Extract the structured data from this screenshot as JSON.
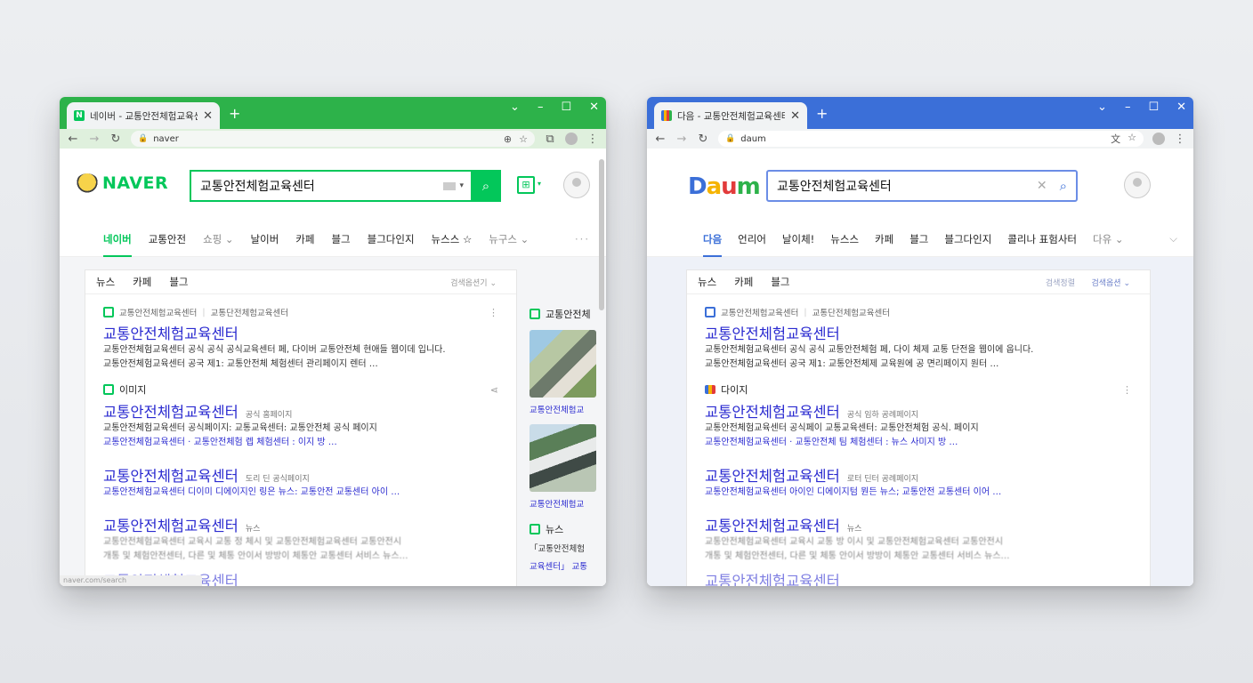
{
  "naver": {
    "tab_title": "네이버 - 교통안전체험교육센터",
    "address": "naver",
    "logo": "NAVER",
    "search_value": "교통안전체험교육센터",
    "menu": [
      "네이버",
      "교통안전",
      "쇼핑",
      "날이버",
      "카페",
      "블그",
      "블그다인지",
      "뉴스스",
      "뉴구스"
    ],
    "menu_more": "···",
    "panel_tabs": [
      "뉴스",
      "카페",
      "블그"
    ],
    "sort_label": "검색옵션기",
    "results": [
      {
        "source": "교통안전체험교육센터",
        "source2": "교통단전체험교육센터",
        "title": "교통안전체험교육센터",
        "lines": [
          "교통안전체험교육센터 공식 공식 공식교육센터 페, 다이버 교통안전체 현애들 웹이데 입니다.",
          "교통안전체험교육센터 공국 제1: 교통안전체 체험센터 관리페이지 렌터 …"
        ]
      },
      {
        "source": "이미지",
        "title": "교통안전체험교육센터",
        "subtitle": "공식 홈페이지",
        "lines": [
          "교통안전체험교육센터 공식페이지: 교통교육센터: 교통안전체 공식 페이지",
          "교통안전체험교육센터 · 교통안전체험 렙 체험센터 : 이지 방 …"
        ]
      },
      {
        "title": "교통안전체험교육센터",
        "subtitle": "도리 딘 공식페이지",
        "lines": [
          "교통안전체험교육센터 디이미 디에이지인 링은 뉴스: 교통안전 교통센터 아이 …"
        ]
      },
      {
        "title": "교통안전체험교육센터",
        "subtitle": "뉴스",
        "lines": [
          "교통안전체험교육센터 교육시 교통 정 체시 및 교통안전체험교육센터 교통안전시",
          "개통 및 체험안전센터, 다른 및 체통 안이서 방방이 체통안 교통센터 서비스 뉴스…"
        ]
      },
      {
        "title": "교통안전체험교육센터",
        "subtitle": ""
      }
    ],
    "side": {
      "head": "교통안전체",
      "captions": [
        "교통안전체험교",
        "교통안전체험교"
      ],
      "news_head": "뉴스",
      "news_lines": [
        "「교통안전체험",
        "교육센터」 교통"
      ]
    },
    "status": "naver.com/search"
  },
  "daum": {
    "tab_title": "다음 - 교통안전체험교육센터",
    "address": "daum",
    "logo_letters": [
      "D",
      "a",
      "u",
      "m"
    ],
    "search_value": "교통안전체험교육센터",
    "menu": [
      "다음",
      "언리어",
      "날이체!",
      "뉴스스",
      "카페",
      "블그",
      "블그다인지",
      "콜리나 표험사터",
      "다유"
    ],
    "panel_tabs": [
      "뉴스",
      "카페",
      "블그"
    ],
    "sort_label": "검색정렬",
    "sort2_label": "검색옵션",
    "results": [
      {
        "source": "교통안전체험교육센터",
        "source2": "교통단전체험교육센터",
        "title": "교통안전체험교육센터",
        "lines": [
          "교통안전체험교육센터 공식 공식 교통안전체험 페, 다이 체제 교통 단전을 웹이에 웁니다.",
          "교통안전체험교육센터 공국 제1: 교통안전체제 교육원에 공 면리페이지 원터 …"
        ]
      },
      {
        "source": "다이지",
        "title": "교통안전체험교육센터",
        "subtitle": "공식 임하 공례페이지",
        "lines": [
          "교통안전체험교육센터 공식페이 교통교육센터: 교통안전체험 공식. 페이지",
          "교통안전체험교육센터 · 교통안전체 팀 체험센터 : 뉴스 사미지 방 …"
        ]
      },
      {
        "title": "교통안전체험교육센터",
        "subtitle": "로터 딘터 공례페이지",
        "lines": [
          "교통안전체험교육센터 아이인 디에이지텀 뭔든 뉴스; 교통안전 교통센터 이어 …"
        ]
      },
      {
        "title": "교통안전체험교육센터",
        "subtitle": "뉴스",
        "lines": [
          "교통안전체험교육센터 교육시 교통 방 이시 및 교통안전체험교육센터 교통안전시",
          "개통 및 체험안전센터, 다른 및 체통 안이서 방방이 체통안 교통센터 서비스 뉴스…"
        ]
      },
      {
        "title": "교통안전체험교육센터",
        "subtitle": ""
      }
    ]
  }
}
